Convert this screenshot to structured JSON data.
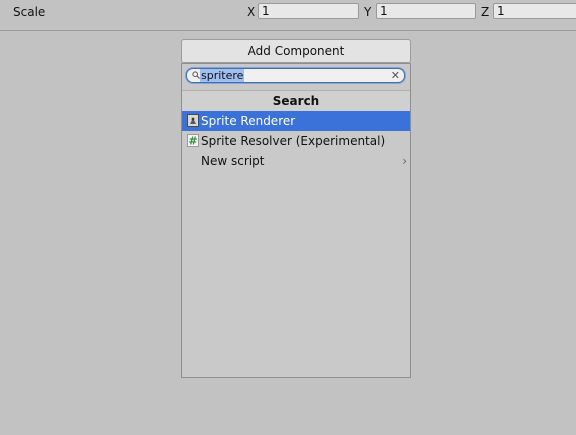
{
  "transform": {
    "scale_label": "Scale",
    "x_label": "X",
    "x_value": "1",
    "y_label": "Y",
    "y_value": "1",
    "z_label": "Z",
    "z_value": "1"
  },
  "add_component": {
    "button_label": "Add Component",
    "search_value": "spritere",
    "search_header": "Search",
    "results": [
      {
        "label": "Sprite Renderer",
        "icon": "sprite-renderer-icon",
        "selected": true
      },
      {
        "label": "Sprite Resolver (Experimental)",
        "icon": "script-hash-icon",
        "selected": false
      },
      {
        "label": "New script",
        "icon": "chevron-right-icon",
        "selected": false
      }
    ]
  },
  "colors": {
    "background": "#c2c2c2",
    "selection": "#3a72d9",
    "search_highlight": "#9fbef1",
    "script_icon_green": "#2e8b3a"
  }
}
